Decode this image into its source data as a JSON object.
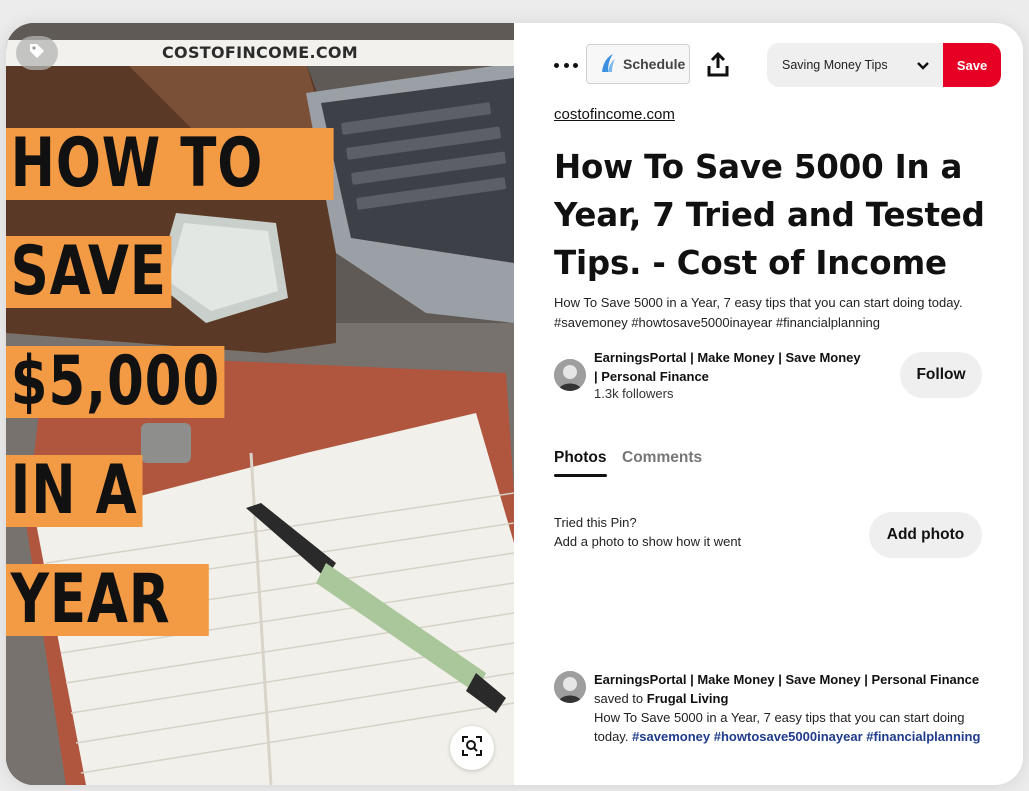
{
  "image": {
    "site_banner": "COSTOFINCOME.COM",
    "headline_lines": [
      "HOW TO",
      "SAVE",
      "$5,000",
      "IN A",
      "YEAR"
    ],
    "accent_color": "#f39a45"
  },
  "toolbar": {
    "more_icon": "more-dots-icon",
    "schedule_label": "Schedule",
    "share_icon": "share-upload-icon",
    "board_selected": "Saving Money Tips",
    "save_label": "Save",
    "save_color": "#e60023"
  },
  "pin": {
    "source": "costofincome.com",
    "title": "How To Save 5000 In a Year, 7 Tried and Tested Tips. - Cost of Income",
    "description": "How To Save 5000 in a Year, 7 easy tips that you can start doing today. #savemoney #howtosave5000inayear #financialplanning"
  },
  "creator": {
    "name": "EarningsPortal | Make Money | Save Money | Personal Finance",
    "followers": "1.3k followers",
    "follow_label": "Follow"
  },
  "tabs": [
    {
      "label": "Photos",
      "active": true
    },
    {
      "label": "Comments",
      "active": false
    }
  ],
  "tried": {
    "line1": "Tried this Pin?",
    "line2": "Add a photo to show how it went",
    "button": "Add photo"
  },
  "activity": {
    "user": "EarningsPortal | Make Money | Save Money | Personal Finance",
    "action": "saved to",
    "board": "Frugal Living",
    "text": "How To Save 5000 in a Year, 7 easy tips that you can start doing today.",
    "hashtags": [
      "#savemoney",
      "#howtosave5000inayear",
      "#financialplanning"
    ]
  }
}
